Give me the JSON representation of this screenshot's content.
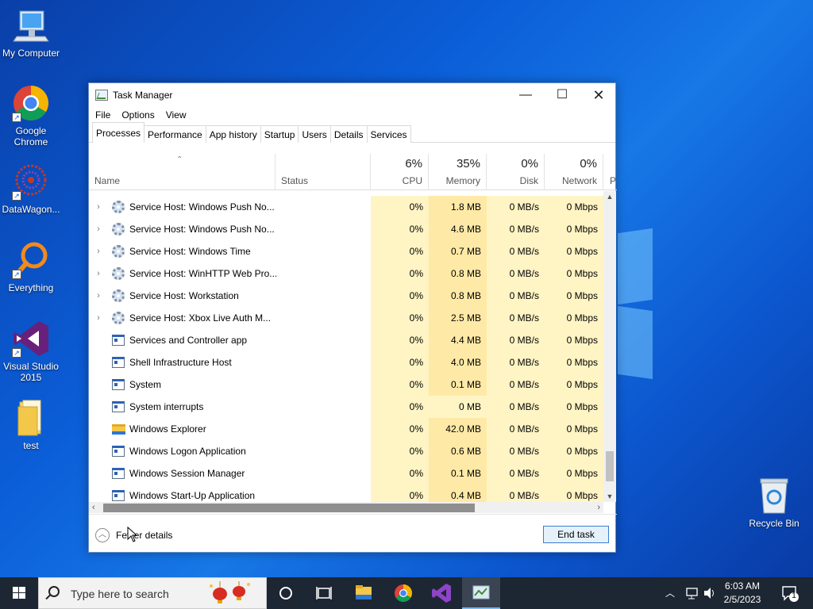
{
  "desktop": {
    "icons": [
      {
        "label": "My Computer"
      },
      {
        "label": "Google Chrome"
      },
      {
        "label": "DataWagon..."
      },
      {
        "label": "Everything"
      },
      {
        "label": "Visual Studio 2015"
      },
      {
        "label": "test"
      },
      {
        "label": "Recycle Bin"
      }
    ]
  },
  "window": {
    "title": "Task Manager",
    "menu": [
      "File",
      "Options",
      "View"
    ],
    "tabs": [
      "Processes",
      "Performance",
      "App history",
      "Startup",
      "Users",
      "Details",
      "Services"
    ],
    "active_tab": "Processes",
    "columns": {
      "name": "Name",
      "status": "Status",
      "cpu": {
        "pct": "6%",
        "label": "CPU"
      },
      "memory": {
        "pct": "35%",
        "label": "Memory"
      },
      "disk": {
        "pct": "0%",
        "label": "Disk"
      },
      "network": {
        "pct": "0%",
        "label": "Network"
      },
      "power_partial": "P"
    },
    "rows": [
      {
        "expandable": true,
        "icon": "gear-icon",
        "name": "Service Host: Windows Push No...",
        "cpu": "0%",
        "memory": "1.8 MB",
        "disk": "0 MB/s",
        "network": "0 Mbps"
      },
      {
        "expandable": true,
        "icon": "gear-icon",
        "name": "Service Host: Windows Push No...",
        "cpu": "0%",
        "memory": "4.6 MB",
        "disk": "0 MB/s",
        "network": "0 Mbps"
      },
      {
        "expandable": true,
        "icon": "gear-icon",
        "name": "Service Host: Windows Time",
        "cpu": "0%",
        "memory": "0.7 MB",
        "disk": "0 MB/s",
        "network": "0 Mbps"
      },
      {
        "expandable": true,
        "icon": "gear-icon",
        "name": "Service Host: WinHTTP Web Pro...",
        "cpu": "0%",
        "memory": "0.8 MB",
        "disk": "0 MB/s",
        "network": "0 Mbps"
      },
      {
        "expandable": true,
        "icon": "gear-icon",
        "name": "Service Host: Workstation",
        "cpu": "0%",
        "memory": "0.8 MB",
        "disk": "0 MB/s",
        "network": "0 Mbps"
      },
      {
        "expandable": true,
        "icon": "gear-icon",
        "name": "Service Host: Xbox Live Auth M...",
        "cpu": "0%",
        "memory": "2.5 MB",
        "disk": "0 MB/s",
        "network": "0 Mbps"
      },
      {
        "expandable": false,
        "icon": "app-window-icon",
        "name": "Services and Controller app",
        "cpu": "0%",
        "memory": "4.4 MB",
        "disk": "0 MB/s",
        "network": "0 Mbps"
      },
      {
        "expandable": false,
        "icon": "app-window-icon",
        "name": "Shell Infrastructure Host",
        "cpu": "0%",
        "memory": "4.0 MB",
        "disk": "0 MB/s",
        "network": "0 Mbps"
      },
      {
        "expandable": false,
        "icon": "app-window-icon",
        "name": "System",
        "cpu": "0%",
        "memory": "0.1 MB",
        "disk": "0 MB/s",
        "network": "0 Mbps"
      },
      {
        "expandable": false,
        "icon": "app-window-icon",
        "name": "System interrupts",
        "cpu": "0%",
        "memory": "0 MB",
        "disk": "0 MB/s",
        "network": "0 Mbps"
      },
      {
        "expandable": false,
        "icon": "folder-icon",
        "name": "Windows Explorer",
        "cpu": "0%",
        "memory": "42.0 MB",
        "disk": "0 MB/s",
        "network": "0 Mbps"
      },
      {
        "expandable": false,
        "icon": "app-window-icon",
        "name": "Windows Logon Application",
        "cpu": "0%",
        "memory": "0.6 MB",
        "disk": "0 MB/s",
        "network": "0 Mbps"
      },
      {
        "expandable": false,
        "icon": "app-window-icon",
        "name": "Windows Session Manager",
        "cpu": "0%",
        "memory": "0.1 MB",
        "disk": "0 MB/s",
        "network": "0 Mbps"
      },
      {
        "expandable": false,
        "icon": "app-window-icon",
        "name": "Windows Start-Up Application",
        "cpu": "0%",
        "memory": "0.4 MB",
        "disk": "0 MB/s",
        "network": "0 Mbps"
      }
    ],
    "footer": {
      "fewer_details": "Fewer details",
      "end_task": "End task"
    }
  },
  "taskbar": {
    "search_placeholder": "Type here to search",
    "time": "6:03 AM",
    "date": "2/5/2023",
    "notification_count": "1"
  },
  "colors": {
    "accent": "#0078d7",
    "cpu_shade": "#fff4c4",
    "memory_shade": "#ffe9a6",
    "taskbar": "#1d2633"
  }
}
